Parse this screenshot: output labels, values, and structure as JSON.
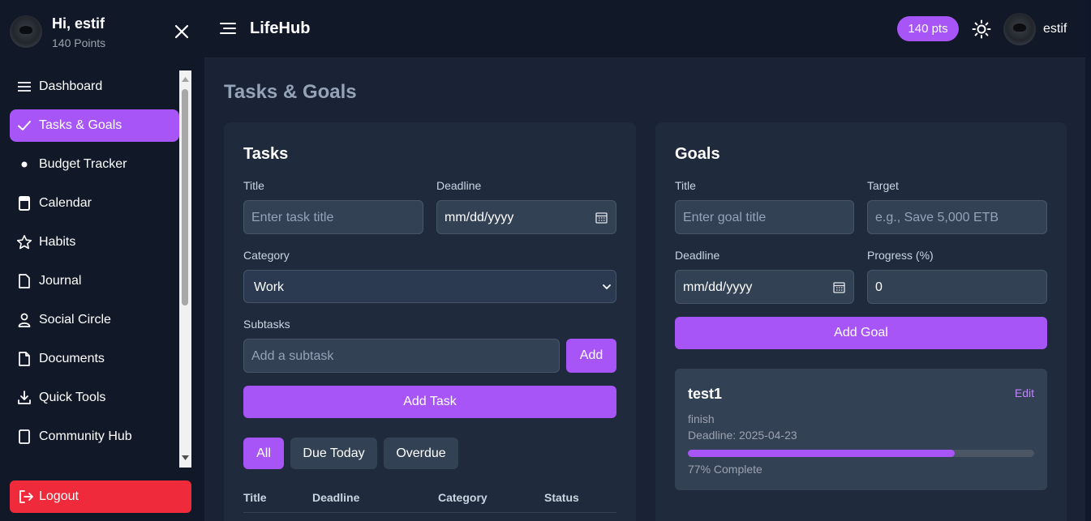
{
  "user": {
    "greeting": "Hi, estif",
    "points_sub": "140 Points",
    "name": "estif"
  },
  "sidebar": {
    "items": [
      {
        "label": "Dashboard",
        "icon": "menu-lines-icon",
        "active": false
      },
      {
        "label": "Tasks & Goals",
        "icon": "check-icon",
        "active": true
      },
      {
        "label": "Budget Tracker",
        "icon": "dot-icon",
        "active": false
      },
      {
        "label": "Calendar",
        "icon": "calendar-icon",
        "active": false
      },
      {
        "label": "Habits",
        "icon": "star-icon",
        "active": false
      },
      {
        "label": "Journal",
        "icon": "file-icon",
        "active": false
      },
      {
        "label": "Social Circle",
        "icon": "user-icon",
        "active": false
      },
      {
        "label": "Documents",
        "icon": "document-icon",
        "active": false
      },
      {
        "label": "Quick Tools",
        "icon": "download-icon",
        "active": false
      },
      {
        "label": "Community Hub",
        "icon": "tablet-icon",
        "active": false
      }
    ],
    "logout_label": "Logout"
  },
  "topbar": {
    "brand": "LifeHub",
    "points_badge": "140 pts"
  },
  "page": {
    "title": "Tasks & Goals"
  },
  "tasks": {
    "title": "Tasks",
    "title_label": "Title",
    "title_placeholder": "Enter task title",
    "deadline_label": "Deadline",
    "deadline_placeholder": "mm/dd/yyyy",
    "category_label": "Category",
    "category_value": "Work",
    "subtasks_label": "Subtasks",
    "subtask_placeholder": "Add a subtask",
    "add_subtask_label": "Add",
    "add_task_label": "Add Task",
    "filters": [
      "All",
      "Due Today",
      "Overdue"
    ],
    "active_filter": "All",
    "table_headers": [
      "Title",
      "Deadline",
      "Category",
      "Status"
    ]
  },
  "goals": {
    "title": "Goals",
    "title_label": "Title",
    "title_placeholder": "Enter goal title",
    "target_label": "Target",
    "target_placeholder": "e.g., Save 5,000 ETB",
    "deadline_label": "Deadline",
    "deadline_placeholder": "mm/dd/yyyy",
    "progress_label": "Progress (%)",
    "progress_value": "0",
    "add_goal_label": "Add Goal",
    "items": [
      {
        "title": "test1",
        "edit_label": "Edit",
        "description": "finish",
        "deadline": "Deadline: 2025-04-23",
        "progress": 77,
        "progress_text": "77% Complete"
      }
    ]
  },
  "colors": {
    "accent": "#a855f7",
    "danger": "#ef2a3a",
    "bg": "#111827",
    "panel": "#1f2a3d"
  }
}
